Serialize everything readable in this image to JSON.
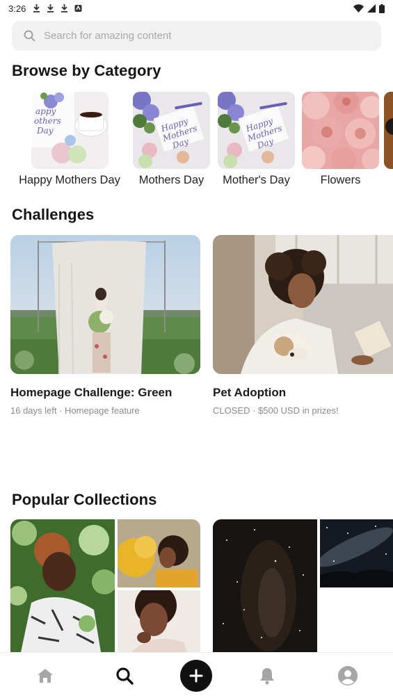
{
  "status_bar": {
    "time": "3:26",
    "left_icons": [
      "download-icon",
      "download-icon",
      "download-icon",
      "app-notification-icon"
    ],
    "right_icons": [
      "wifi-icon",
      "signal-icon",
      "battery-icon"
    ]
  },
  "search": {
    "placeholder": "Search for amazing content",
    "icon": "search-icon"
  },
  "sections": {
    "browse_title": "Browse by Category",
    "challenges_title": "Challenges",
    "collections_title": "Popular Collections"
  },
  "categories": [
    {
      "label": "Happy Mothers Day"
    },
    {
      "label": "Mothers Day"
    },
    {
      "label": "Mother's Day"
    },
    {
      "label": "Flowers"
    }
  ],
  "challenges": [
    {
      "title": "Homepage Challenge: Green",
      "subtitle": "16 days left · Homepage feature"
    },
    {
      "title": "Pet Adoption",
      "subtitle": "CLOSED · $500 USD in prizes!"
    }
  ],
  "bottom_nav": {
    "items": [
      "home-icon",
      "search-icon",
      "add-icon",
      "bell-icon",
      "profile-icon"
    ],
    "active": "search-icon",
    "active_color": "#111111",
    "inactive_color": "#a6a6a6"
  },
  "theme": {
    "accent": "#111111",
    "background": "#ffffff",
    "search_bg": "#f1f1f1"
  }
}
